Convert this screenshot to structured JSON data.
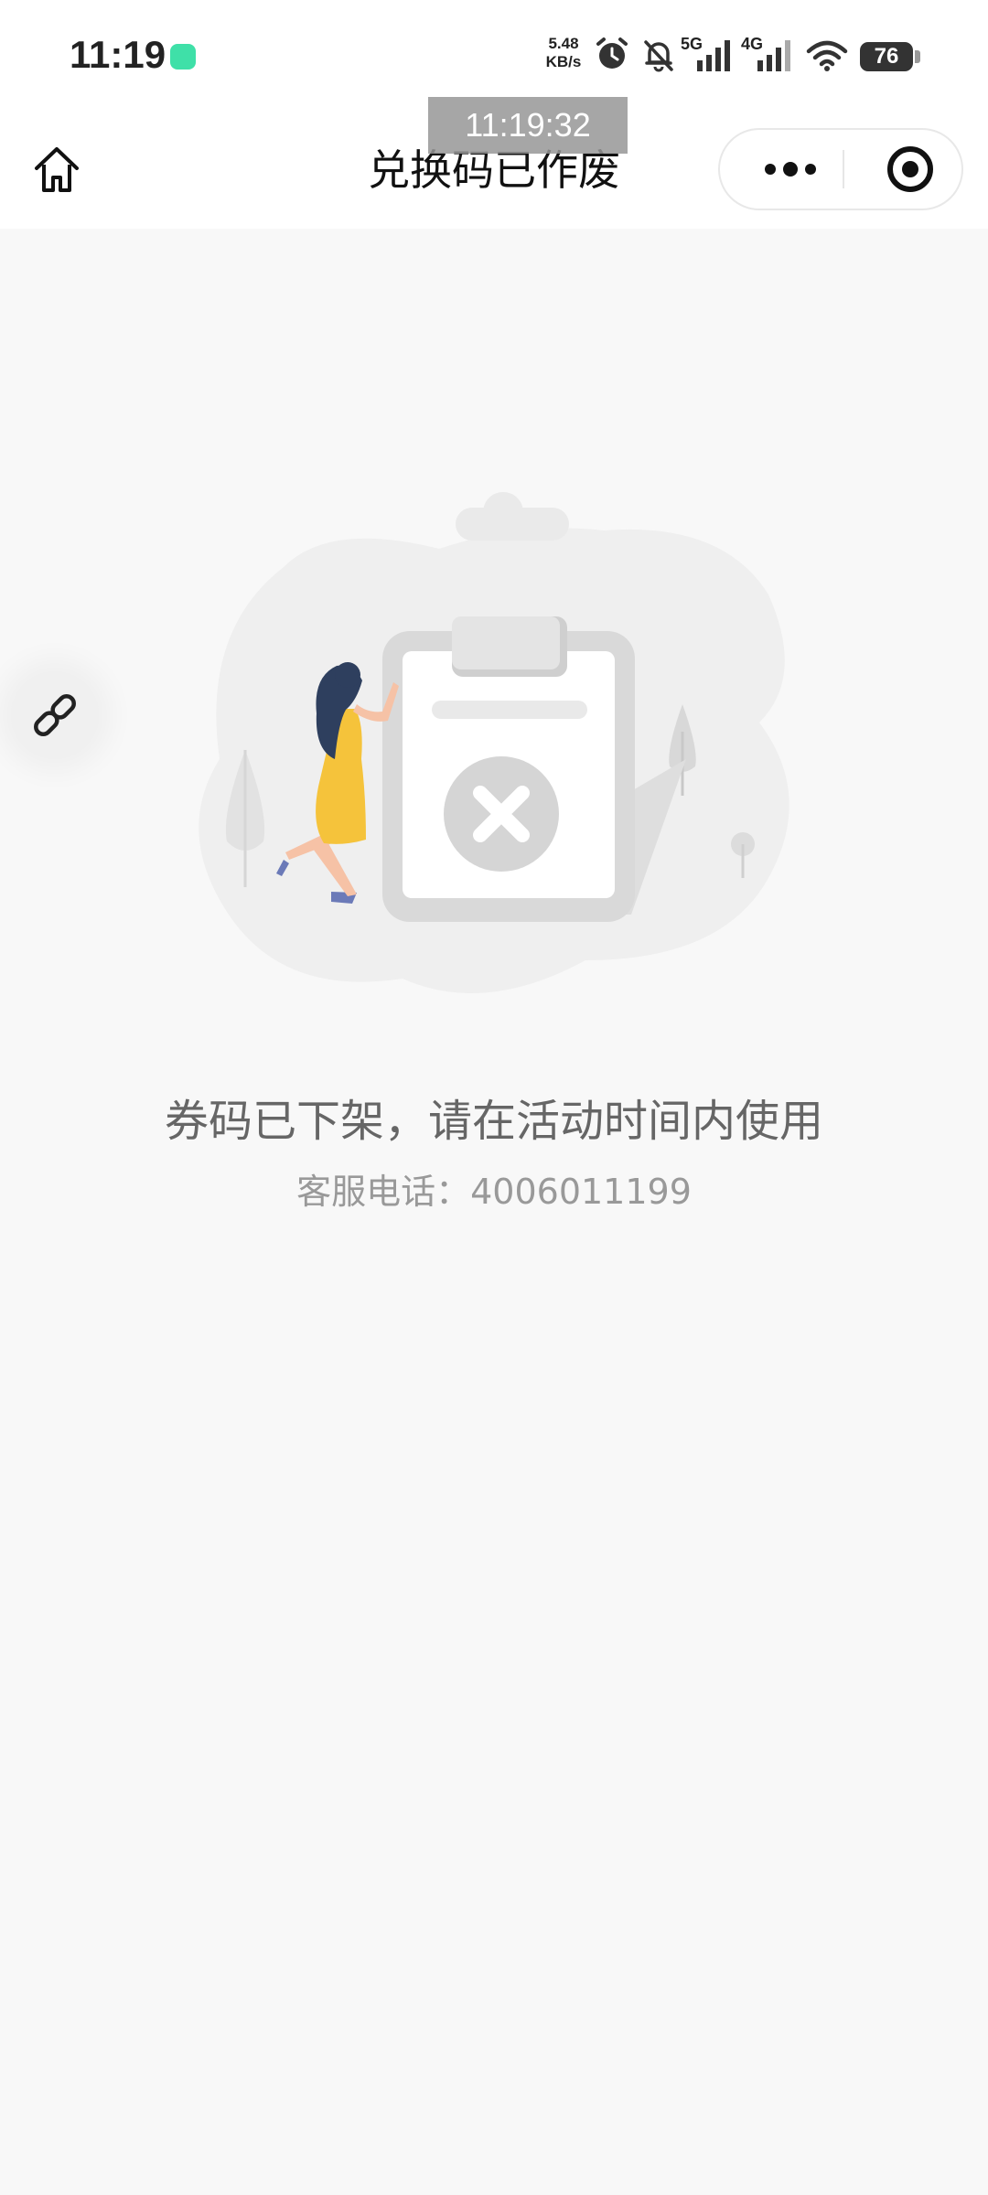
{
  "status_bar": {
    "time": "11:19",
    "net_speed_value": "5.48",
    "net_speed_unit": "KB/s",
    "network_labels": [
      "5G",
      "4G"
    ],
    "battery": "76",
    "icons": [
      "wechat-icon",
      "alarm-icon",
      "bell-muted-icon",
      "signal-icon",
      "wifi-icon",
      "battery-icon"
    ]
  },
  "overlay": {
    "timestamp": "11:19:32"
  },
  "nav": {
    "title": "兑换码已作废",
    "icons": [
      "home-icon",
      "more-dots-icon",
      "close-target-icon"
    ]
  },
  "floating": {
    "icon": "link-icon"
  },
  "content": {
    "message": "券码已下架，请在活动时间内使用",
    "service_label": "客服电话：",
    "service_phone": "4006011199"
  },
  "colors": {
    "background": "#f8f8f8",
    "message_text": "#666666",
    "secondary_text": "#999999",
    "wechat_green": "#3fe0a8",
    "dress_yellow": "#f5c33b",
    "hair_navy": "#2e3f5e"
  }
}
